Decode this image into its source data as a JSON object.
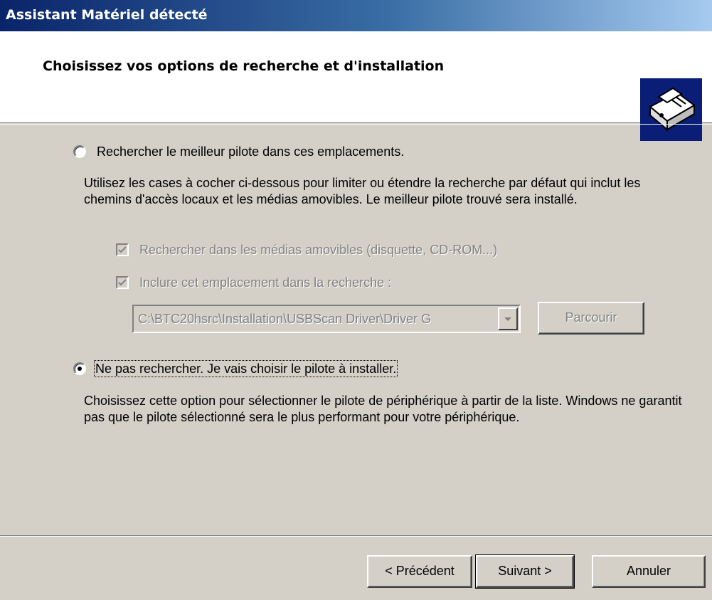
{
  "window": {
    "title": "Assistant Matériel détecté"
  },
  "header": {
    "title": "Choisissez vos options de recherche et d'installation",
    "icon": "hardware-wizard-icon"
  },
  "option_search": {
    "label": "Rechercher le meilleur pilote dans ces emplacements.",
    "selected": false,
    "description": "Utilisez les cases à cocher ci-dessous pour limiter ou étendre la recherche par défaut qui inclut les chemins d'accès locaux et les médias amovibles. Le meilleur pilote trouvé sera installé.",
    "removable_media": {
      "label": "Rechercher dans les médias amovibles (disquette, CD-ROM...)",
      "checked": true,
      "enabled": false
    },
    "include_location": {
      "label": "Inclure cet emplacement dans la recherche :",
      "checked": true,
      "enabled": false
    },
    "location_value": "C:\\BTC20hsrc\\Installation\\USBScan Driver\\Driver G",
    "browse_label": "Parcourir"
  },
  "option_manual": {
    "label": "Ne pas rechercher. Je vais choisir le pilote à installer.",
    "selected": true,
    "description": "Choisissez cette option pour sélectionner le pilote de périphérique à partir de la liste. Windows ne garantit pas que le pilote sélectionné sera le plus performant pour votre périphérique."
  },
  "footer": {
    "back_label": "< Précédent",
    "next_label": "Suivant >",
    "cancel_label": "Annuler"
  }
}
